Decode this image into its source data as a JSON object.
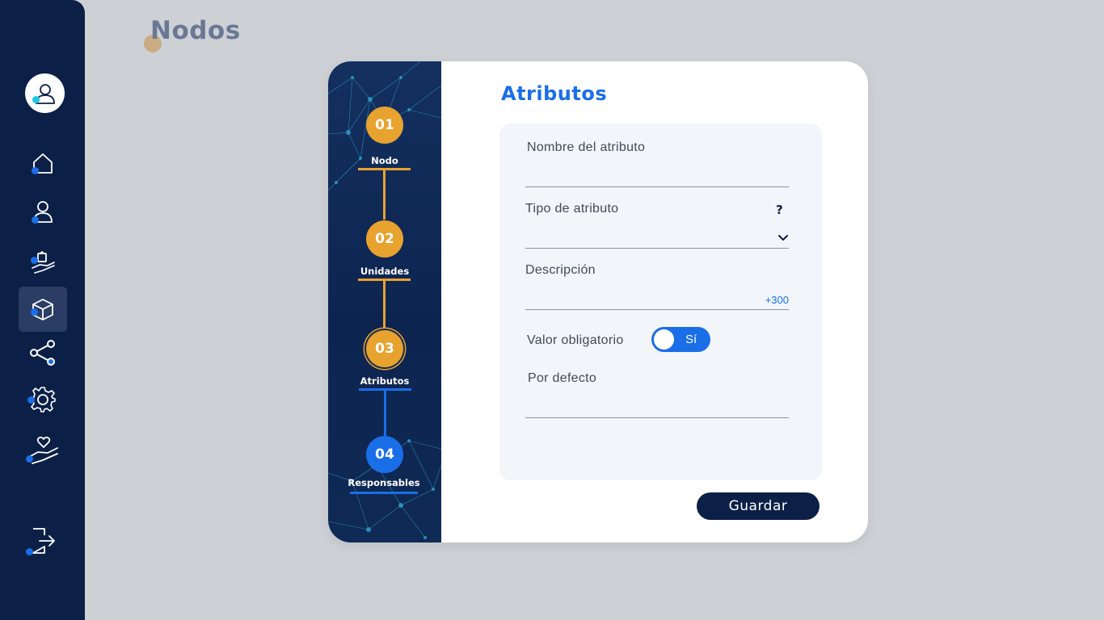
{
  "page": {
    "title": "Nodos"
  },
  "sidebar": {
    "avatar_icon": "user-circle-icon",
    "items": [
      {
        "icon": "home-icon",
        "active": false
      },
      {
        "icon": "user-icon",
        "active": false
      },
      {
        "icon": "hand-bag-icon",
        "active": false
      },
      {
        "icon": "cube-icon",
        "active": true
      },
      {
        "icon": "share-nodes-icon",
        "active": false
      },
      {
        "icon": "gear-icon",
        "active": false
      },
      {
        "icon": "hand-heart-icon",
        "active": false
      }
    ],
    "logout_icon": "logout-icon"
  },
  "stepper": {
    "steps": [
      {
        "number": "01",
        "label": "Nodo",
        "state": "done"
      },
      {
        "number": "02",
        "label": "Unidades",
        "state": "done"
      },
      {
        "number": "03",
        "label": "Atributos",
        "state": "current"
      },
      {
        "number": "04",
        "label": "Responsables",
        "state": "todo"
      }
    ]
  },
  "form": {
    "title": "Atributos",
    "fields": {
      "name": {
        "label": "Nombre del atributo",
        "value": ""
      },
      "type": {
        "label": "Tipo de atributo",
        "value": "",
        "help_icon": "question-icon",
        "dropdown_icon": "chevron-down-icon"
      },
      "description": {
        "label": "Descripción",
        "value": "",
        "counter": "+300"
      },
      "required": {
        "label": "Valor obligatorio",
        "toggle_text": "Sí",
        "on": true
      },
      "default": {
        "label": "Por defecto",
        "value": ""
      }
    },
    "save_label": "Guardar"
  },
  "colors": {
    "sidebar": "#0c2047",
    "accent_blue": "#1a6ee8",
    "accent_orange": "#e8a22e",
    "background": "#cdd1d6"
  }
}
